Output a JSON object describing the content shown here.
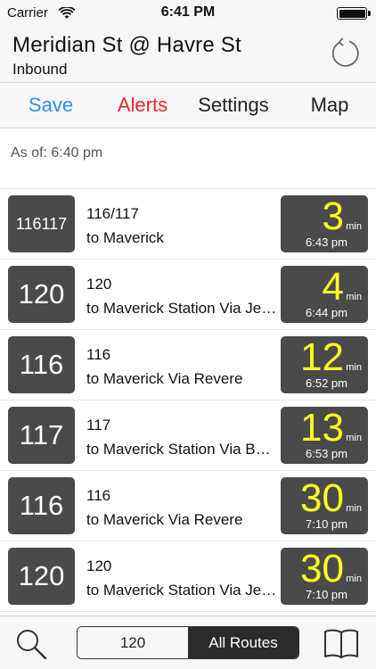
{
  "status_bar": {
    "carrier": "Carrier",
    "time": "6:41 PM",
    "icons": [
      "wifi-icon",
      "battery-icon"
    ]
  },
  "header": {
    "stop_name": "Meridian St @ Havre St",
    "direction": "Inbound",
    "refresh_icon": "refresh-icon"
  },
  "toolbar": {
    "save_label": "Save",
    "alerts_label": "Alerts",
    "settings_label": "Settings",
    "map_label": "Map",
    "colors": {
      "save": "#2f8ef0",
      "alerts": "#e8262a"
    }
  },
  "as_of": "As of: 6:40 pm",
  "predictions": [
    {
      "route_badge": "116117",
      "route": "116/117",
      "destination": "to Maverick",
      "minutes": "3",
      "unit": "min",
      "arrival": "6:43 pm"
    },
    {
      "route_badge": "120",
      "route": "120",
      "destination": "to Maverick Station Via Jeffries Point",
      "minutes": "4",
      "unit": "min",
      "arrival": "6:44 pm"
    },
    {
      "route_badge": "116",
      "route": "116",
      "destination": "to Maverick Via Revere",
      "minutes": "12",
      "unit": "min",
      "arrival": "6:52 pm"
    },
    {
      "route_badge": "117",
      "route": "117",
      "destination": "to Maverick Station Via Beach St",
      "minutes": "13",
      "unit": "min",
      "arrival": "6:53 pm"
    },
    {
      "route_badge": "116",
      "route": "116",
      "destination": "to Maverick Via Revere",
      "minutes": "30",
      "unit": "min",
      "arrival": "7:10 pm"
    },
    {
      "route_badge": "120",
      "route": "120",
      "destination": "to Maverick Station Via Jeffries Point",
      "minutes": "30",
      "unit": "min",
      "arrival": "7:10 pm"
    }
  ],
  "bottom_bar": {
    "filter_route": "120",
    "filter_all": "All Routes",
    "icons": [
      "search-icon",
      "book-icon"
    ]
  },
  "colors": {
    "eta_minutes": "#ffff22",
    "badge_bg": "#4a4a4a"
  }
}
